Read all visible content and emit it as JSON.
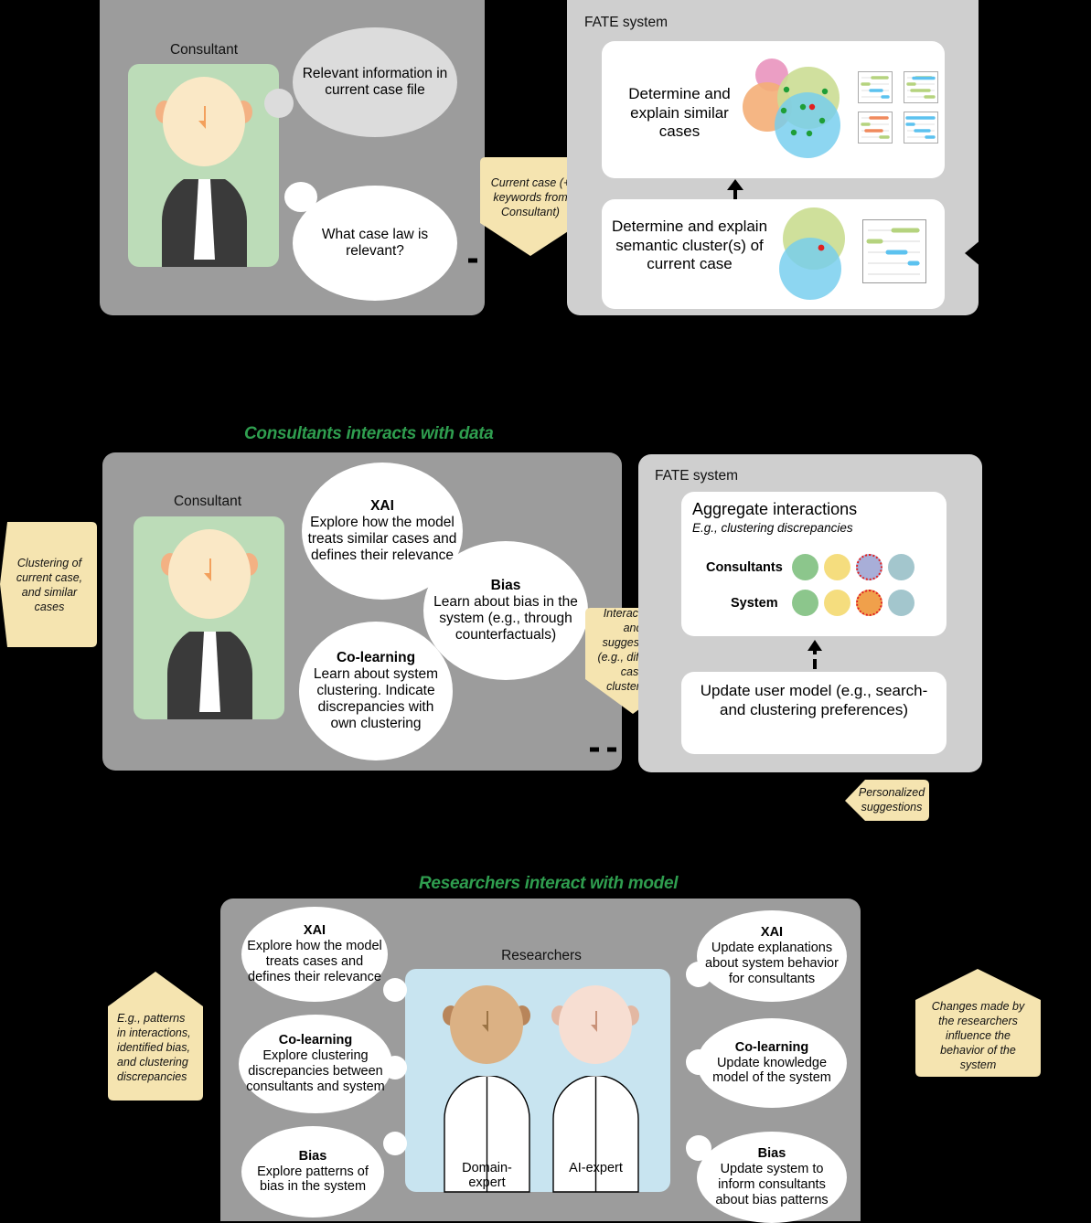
{
  "section_titles": {
    "consultants": "Consultants interacts with data",
    "researchers": "Researchers interact with model"
  },
  "top": {
    "left_panel": {
      "person_label": "Consultant",
      "bubbles": [
        {
          "id": "relevant-info",
          "text": "Relevant information in current case file",
          "style": "grey"
        },
        {
          "id": "what-case-law",
          "text": "What case law is relevant?",
          "style": "white"
        }
      ]
    },
    "callout": "Current case (+ keywords from Consultant)",
    "right_panel": {
      "label": "FATE system",
      "cards": [
        {
          "id": "similar-cases",
          "text": "Determine and explain similar cases"
        },
        {
          "id": "semantic-cluster",
          "text": "Determine and explain semantic cluster(s) of current case"
        }
      ]
    }
  },
  "middle": {
    "left_callout": "Clustering of current case, and similar cases",
    "left_panel": {
      "person_label": "Consultant",
      "bubbles": [
        {
          "id": "xai",
          "title": "XAI",
          "text": "Explore how the model treats similar cases and defines their relevance"
        },
        {
          "id": "bias",
          "title": "Bias",
          "text": "Learn about bias in the system (e.g., through counterfactuals)"
        },
        {
          "id": "co-learning",
          "title": "Co-learning",
          "text": "Learn about system clustering. Indicate discrepancies with own clustering"
        }
      ]
    },
    "center_callout": "Interactions and suggestions (e.g., different case clustering)",
    "right_panel": {
      "label": "FATE system",
      "aggregate": {
        "title": "Aggregate interactions",
        "subtitle": "E.g., clustering discrepancies",
        "rows": [
          {
            "label": "Consultants",
            "dots": [
              "#8cc68c",
              "#f5dd7e",
              "#a8aed8",
              "#a3c6cd"
            ],
            "highlight_index": 2
          },
          {
            "label": "System",
            "dots": [
              "#8cc68c",
              "#f5dd7e",
              "#f0a04b",
              "#a3c6cd"
            ],
            "highlight_index": 2
          }
        ],
        "highlight_color": "#e02020"
      },
      "update_card": "Update user model (e.g., search- and clustering preferences)"
    },
    "bottom_callout": "Personalized suggestions"
  },
  "bottom": {
    "left_callout": "E.g., patterns in interactions, identified bias, and clustering discrepancies",
    "right_callout": "Changes made by the researchers influence the behavior of the system",
    "panel": {
      "person_label": "Researchers",
      "experts": [
        "Domain-expert",
        "AI-expert"
      ],
      "left_bubbles": [
        {
          "id": "xai",
          "title": "XAI",
          "text": "Explore how the model treats cases and defines their relevance"
        },
        {
          "id": "co-learning",
          "title": "Co-learning",
          "text": "Explore clustering discrepancies between consultants and system"
        },
        {
          "id": "bias",
          "title": "Bias",
          "text": "Explore patterns of bias in the system"
        }
      ],
      "right_bubbles": [
        {
          "id": "xai",
          "title": "XAI",
          "text": "Update explanations about system behavior for consultants"
        },
        {
          "id": "co-learning",
          "title": "Co-learning",
          "text": "Update knowledge model of the system"
        },
        {
          "id": "bias",
          "title": "Bias",
          "text": "Update system to inform consultants about bias patterns"
        }
      ]
    }
  },
  "colors": {
    "panel": "#9c9c9c",
    "panel_light": "#cfcfcf",
    "callout": "#f5e4b0",
    "consultant_card": "#bcdcb8",
    "researcher_card": "#c8e4f0",
    "title_green": "#2f9e4f",
    "venn_green": "#cbdd93",
    "venn_blue": "#74cdee",
    "venn_orange": "#f4ae77",
    "venn_pink": "#eb9ec4",
    "dot_green": "#1e9e37",
    "dot_red": "#e02020"
  }
}
